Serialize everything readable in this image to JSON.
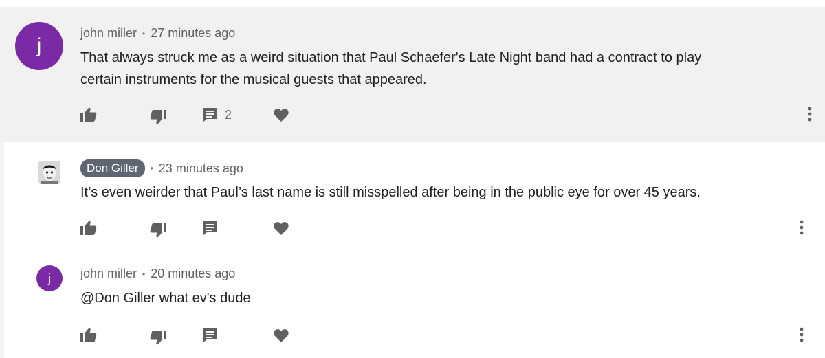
{
  "comments": [
    {
      "author": "john miller",
      "avatar_letter": "j",
      "avatar_color": "#7b2aa6",
      "time": "27 minutes ago",
      "text_lines": [
        "That always struck me as a weird situation that Paul Schaefer's Late Night band had a contract to play",
        "certain instruments for the musical guests that appeared."
      ],
      "reply_count": "2"
    },
    {
      "author": "Don Giller",
      "author_badge_color": "#5f6672",
      "time": "23 minutes ago",
      "text_lines": [
        "It’s even weirder that Paul’s last name is still misspelled after being in the public eye for over 45 years."
      ]
    },
    {
      "author": "john miller",
      "avatar_letter": "j",
      "avatar_color": "#7b2aa6",
      "time": "20 minutes ago",
      "text_lines": [
        "@Don Giller what ev's dude"
      ]
    }
  ],
  "icons": {
    "like": "thumbs-up-icon",
    "dislike": "thumbs-down-icon",
    "reply": "comment-icon",
    "heart": "heart-icon",
    "more": "more-vert-icon"
  },
  "colors": {
    "highlight_background": "#f1f1f1",
    "icon": "#606060",
    "text": "#212121"
  }
}
